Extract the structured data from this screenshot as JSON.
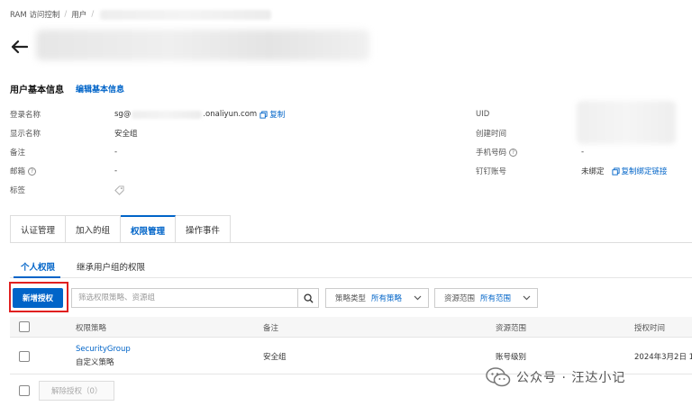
{
  "breadcrumb": {
    "item1": "RAM 访问控制",
    "item2": "用户"
  },
  "user_info": {
    "section_title": "用户基本信息",
    "edit_link": "编辑基本信息",
    "login_name_label": "登录名称",
    "login_name_prefix": "sg@",
    "login_name_suffix": ".onaliyun.com",
    "copy_label": "复制",
    "display_name_label": "显示名称",
    "display_name_value": "安全组",
    "remark_label": "备注",
    "remark_value": "-",
    "email_label": "邮箱",
    "email_value": "-",
    "tags_label": "标签",
    "uid_label": "UID",
    "created_label": "创建时间",
    "phone_label": "手机号码",
    "phone_value": "-",
    "dingtalk_label": "钉钉账号",
    "dingtalk_value": "未绑定",
    "copy_bind_link": "复制绑定链接"
  },
  "tabs": [
    {
      "label": "认证管理"
    },
    {
      "label": "加入的组"
    },
    {
      "label": "权限管理"
    },
    {
      "label": "操作事件"
    }
  ],
  "subtabs": [
    {
      "label": "个人权限"
    },
    {
      "label": "继承用户组的权限"
    }
  ],
  "toolbar": {
    "add_button": "新增授权",
    "search_placeholder": "筛选权限策略、资源组",
    "policy_type_label": "策略类型",
    "policy_type_value": "所有策略",
    "resource_scope_label": "资源范围",
    "resource_scope_value": "所有范围"
  },
  "table": {
    "headers": [
      "权限策略",
      "备注",
      "资源范围",
      "授权时间"
    ],
    "rows": [
      {
        "policy_name": "SecurityGroup",
        "policy_type": "自定义策略",
        "remark": "安全组",
        "scope": "账号级别",
        "time": "2024年3月2日 1"
      }
    ]
  },
  "footer": {
    "remove_button": "解除授权（0）"
  },
  "watermark": {
    "text": "公众号 · 汪达小记"
  },
  "colors": {
    "accent": "#0064c8",
    "highlight": "#e02020"
  }
}
